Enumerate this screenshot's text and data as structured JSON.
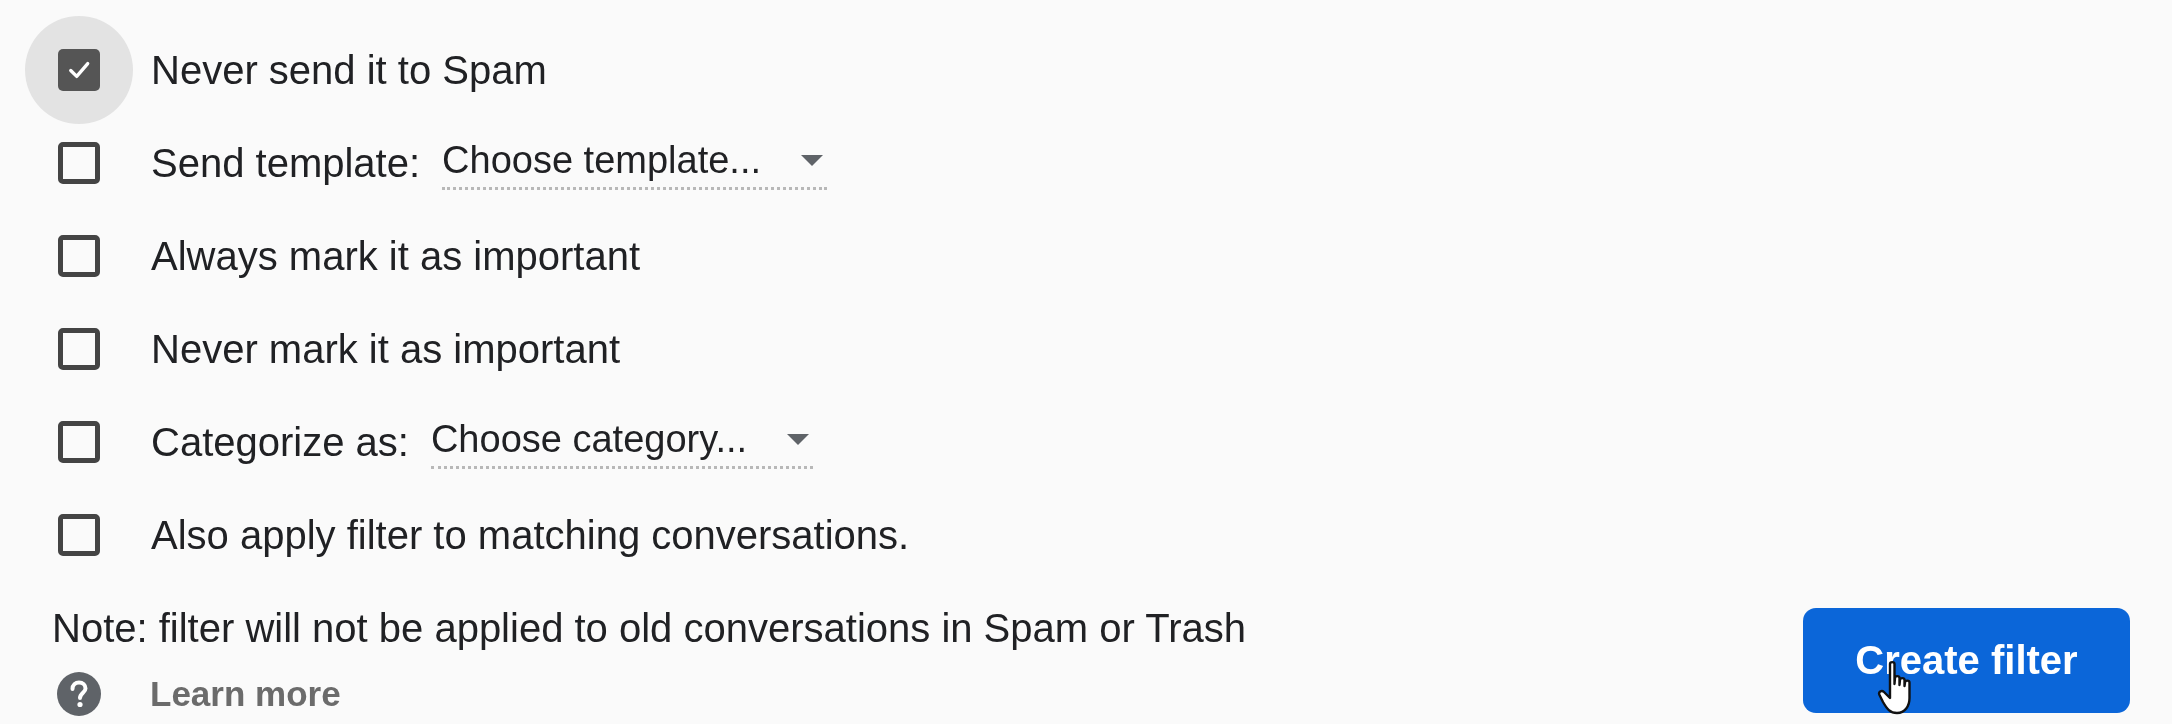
{
  "actions": [
    {
      "kind": "checkbox",
      "label": "Never send it to Spam",
      "checked": true,
      "focused": true
    },
    {
      "kind": "select",
      "label": "Send template:",
      "value": "Choose template...",
      "checked": false,
      "focused": false
    },
    {
      "kind": "checkbox",
      "label": "Always mark it as important",
      "checked": false,
      "focused": false
    },
    {
      "kind": "checkbox",
      "label": "Never mark it as important",
      "checked": false,
      "focused": false
    },
    {
      "kind": "select",
      "label": "Categorize as:",
      "value": "Choose category...",
      "checked": false,
      "focused": false
    },
    {
      "kind": "checkbox",
      "label": "Also apply filter to matching conversations.",
      "checked": false,
      "focused": false
    }
  ],
  "note": "Note: filter will not be applied to old conversations in Spam or Trash",
  "help_link": "Learn more",
  "create_button": {
    "label": "Create filter",
    "hovered": true
  }
}
